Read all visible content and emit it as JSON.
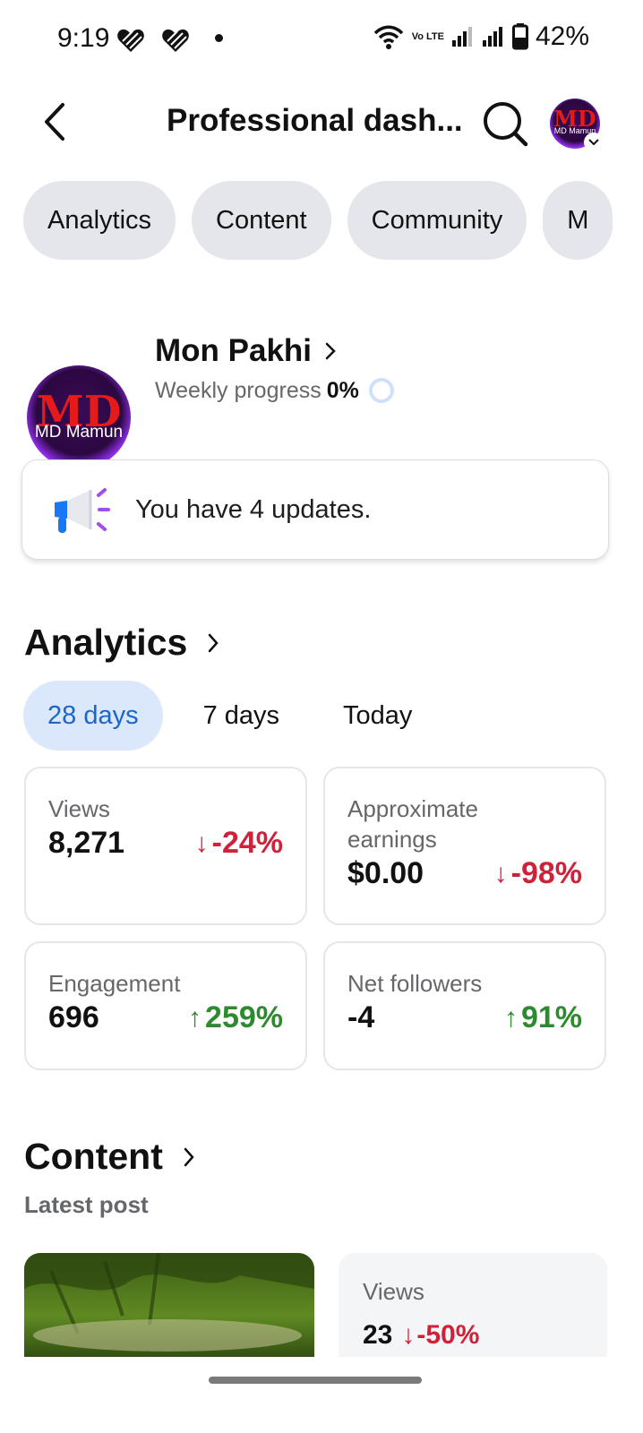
{
  "status_bar": {
    "time": "9:19",
    "battery": "42%",
    "network_label": "Vo LTE"
  },
  "header": {
    "title": "Professional dash...",
    "avatar": {
      "monogram": "MD",
      "caption": "MD Mamun"
    }
  },
  "tabs": [
    {
      "label": "Analytics"
    },
    {
      "label": "Content"
    },
    {
      "label": "Community"
    },
    {
      "label": "M"
    }
  ],
  "profile": {
    "name": "Mon Pakhi",
    "weekly_progress_label": "Weekly progress",
    "weekly_progress_value": "0%",
    "weekly_progress_fraction": 0,
    "avatar": {
      "monogram": "MD",
      "caption": "MD Mamun"
    }
  },
  "updates": {
    "text": "You have 4 updates."
  },
  "analytics": {
    "title": "Analytics",
    "periods": [
      {
        "label": "28 days",
        "active": true
      },
      {
        "label": "7 days",
        "active": false
      },
      {
        "label": "Today",
        "active": false
      }
    ],
    "cards": {
      "views": {
        "label": "Views",
        "value": "8,271",
        "change": "-24%",
        "direction": "down"
      },
      "earnings": {
        "label": "Approximate earnings",
        "value": "$0.00",
        "change": "-98%",
        "direction": "down"
      },
      "engagement": {
        "label": "Engagement",
        "value": "696",
        "change": "259%",
        "direction": "up"
      },
      "followers": {
        "label": "Net followers",
        "value": "-4",
        "change": "91%",
        "direction": "up"
      }
    }
  },
  "content": {
    "title": "Content",
    "latest_label": "Latest post",
    "latest_post": {
      "views_label": "Views",
      "views_value": "23",
      "views_change": "-50%",
      "direction": "down"
    }
  },
  "colors": {
    "accent_blue": "#1a66c9",
    "active_pill_bg": "#dbe8fb",
    "negative_red": "#d0213a",
    "positive_green": "#2e8a2e",
    "chip_bg": "#e4e6eb"
  }
}
